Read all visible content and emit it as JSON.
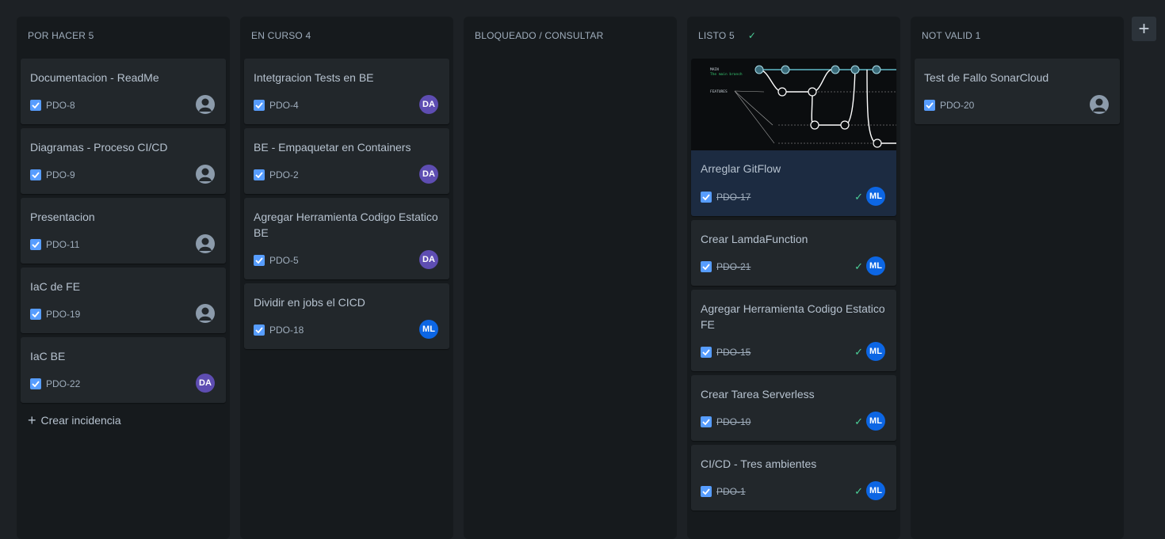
{
  "board": {
    "columns": [
      {
        "title": "POR HACER 5",
        "create_label": "Crear incidencia",
        "cards": [
          {
            "title": "Documentacion - ReadMe",
            "key": "PDO-8",
            "assignee": ""
          },
          {
            "title": "Diagramas - Proceso CI/CD",
            "key": "PDO-9",
            "assignee": ""
          },
          {
            "title": "Presentacion",
            "key": "PDO-11",
            "assignee": ""
          },
          {
            "title": "IaC de FE",
            "key": "PDO-19",
            "assignee": ""
          },
          {
            "title": "IaC BE",
            "key": "PDO-22",
            "assignee": "DA"
          }
        ]
      },
      {
        "title": "EN CURSO 4",
        "cards": [
          {
            "title": "Intetgracion Tests en BE",
            "key": "PDO-4",
            "assignee": "DA"
          },
          {
            "title": "BE - Empaquetar en Containers",
            "key": "PDO-2",
            "assignee": "DA"
          },
          {
            "title": "Agregar Herramienta Codigo Estatico BE",
            "key": "PDO-5",
            "assignee": "DA"
          },
          {
            "title": "Dividir en jobs el CICD",
            "key": "PDO-18",
            "assignee": "ML"
          }
        ]
      },
      {
        "title": "BLOQUEADO / CONSULTAR",
        "cards": []
      },
      {
        "title": "LISTO 5",
        "cards": [
          {
            "title": "Arreglar GitFlow",
            "key": "PDO-17",
            "assignee": "ML",
            "image_text": [
              "MAIN",
              "The main branch",
              "FEATURES"
            ]
          },
          {
            "title": "Crear LamdaFunction",
            "key": "PDO-21",
            "assignee": "ML"
          },
          {
            "title": "Agregar Herramienta Codigo Estatico FE",
            "key": "PDO-15",
            "assignee": "ML"
          },
          {
            "title": "Crear Tarea Serverless",
            "key": "PDO-10",
            "assignee": "ML"
          },
          {
            "title": "CI/CD - Tres ambientes",
            "key": "PDO-1",
            "assignee": "ML"
          }
        ]
      },
      {
        "title": "NOT VALID 1",
        "cards": [
          {
            "title": "Test de Fallo SonarCloud",
            "key": "PDO-20",
            "assignee": ""
          }
        ]
      }
    ]
  },
  "colors": {
    "background": "#1d2125",
    "column": "#161a1d",
    "card": "#22272b",
    "selected_card": "#1c2b41",
    "checkbox": "#579dff",
    "done_check": "#4bce97",
    "avatar_da": "#5e4db2",
    "avatar_ml": "#0c66e4"
  },
  "icons": {
    "checkbox": "checkbox-checked-icon",
    "done": "check-icon",
    "add_column": "plus-icon",
    "unassigned": "user-avatar-icon"
  }
}
